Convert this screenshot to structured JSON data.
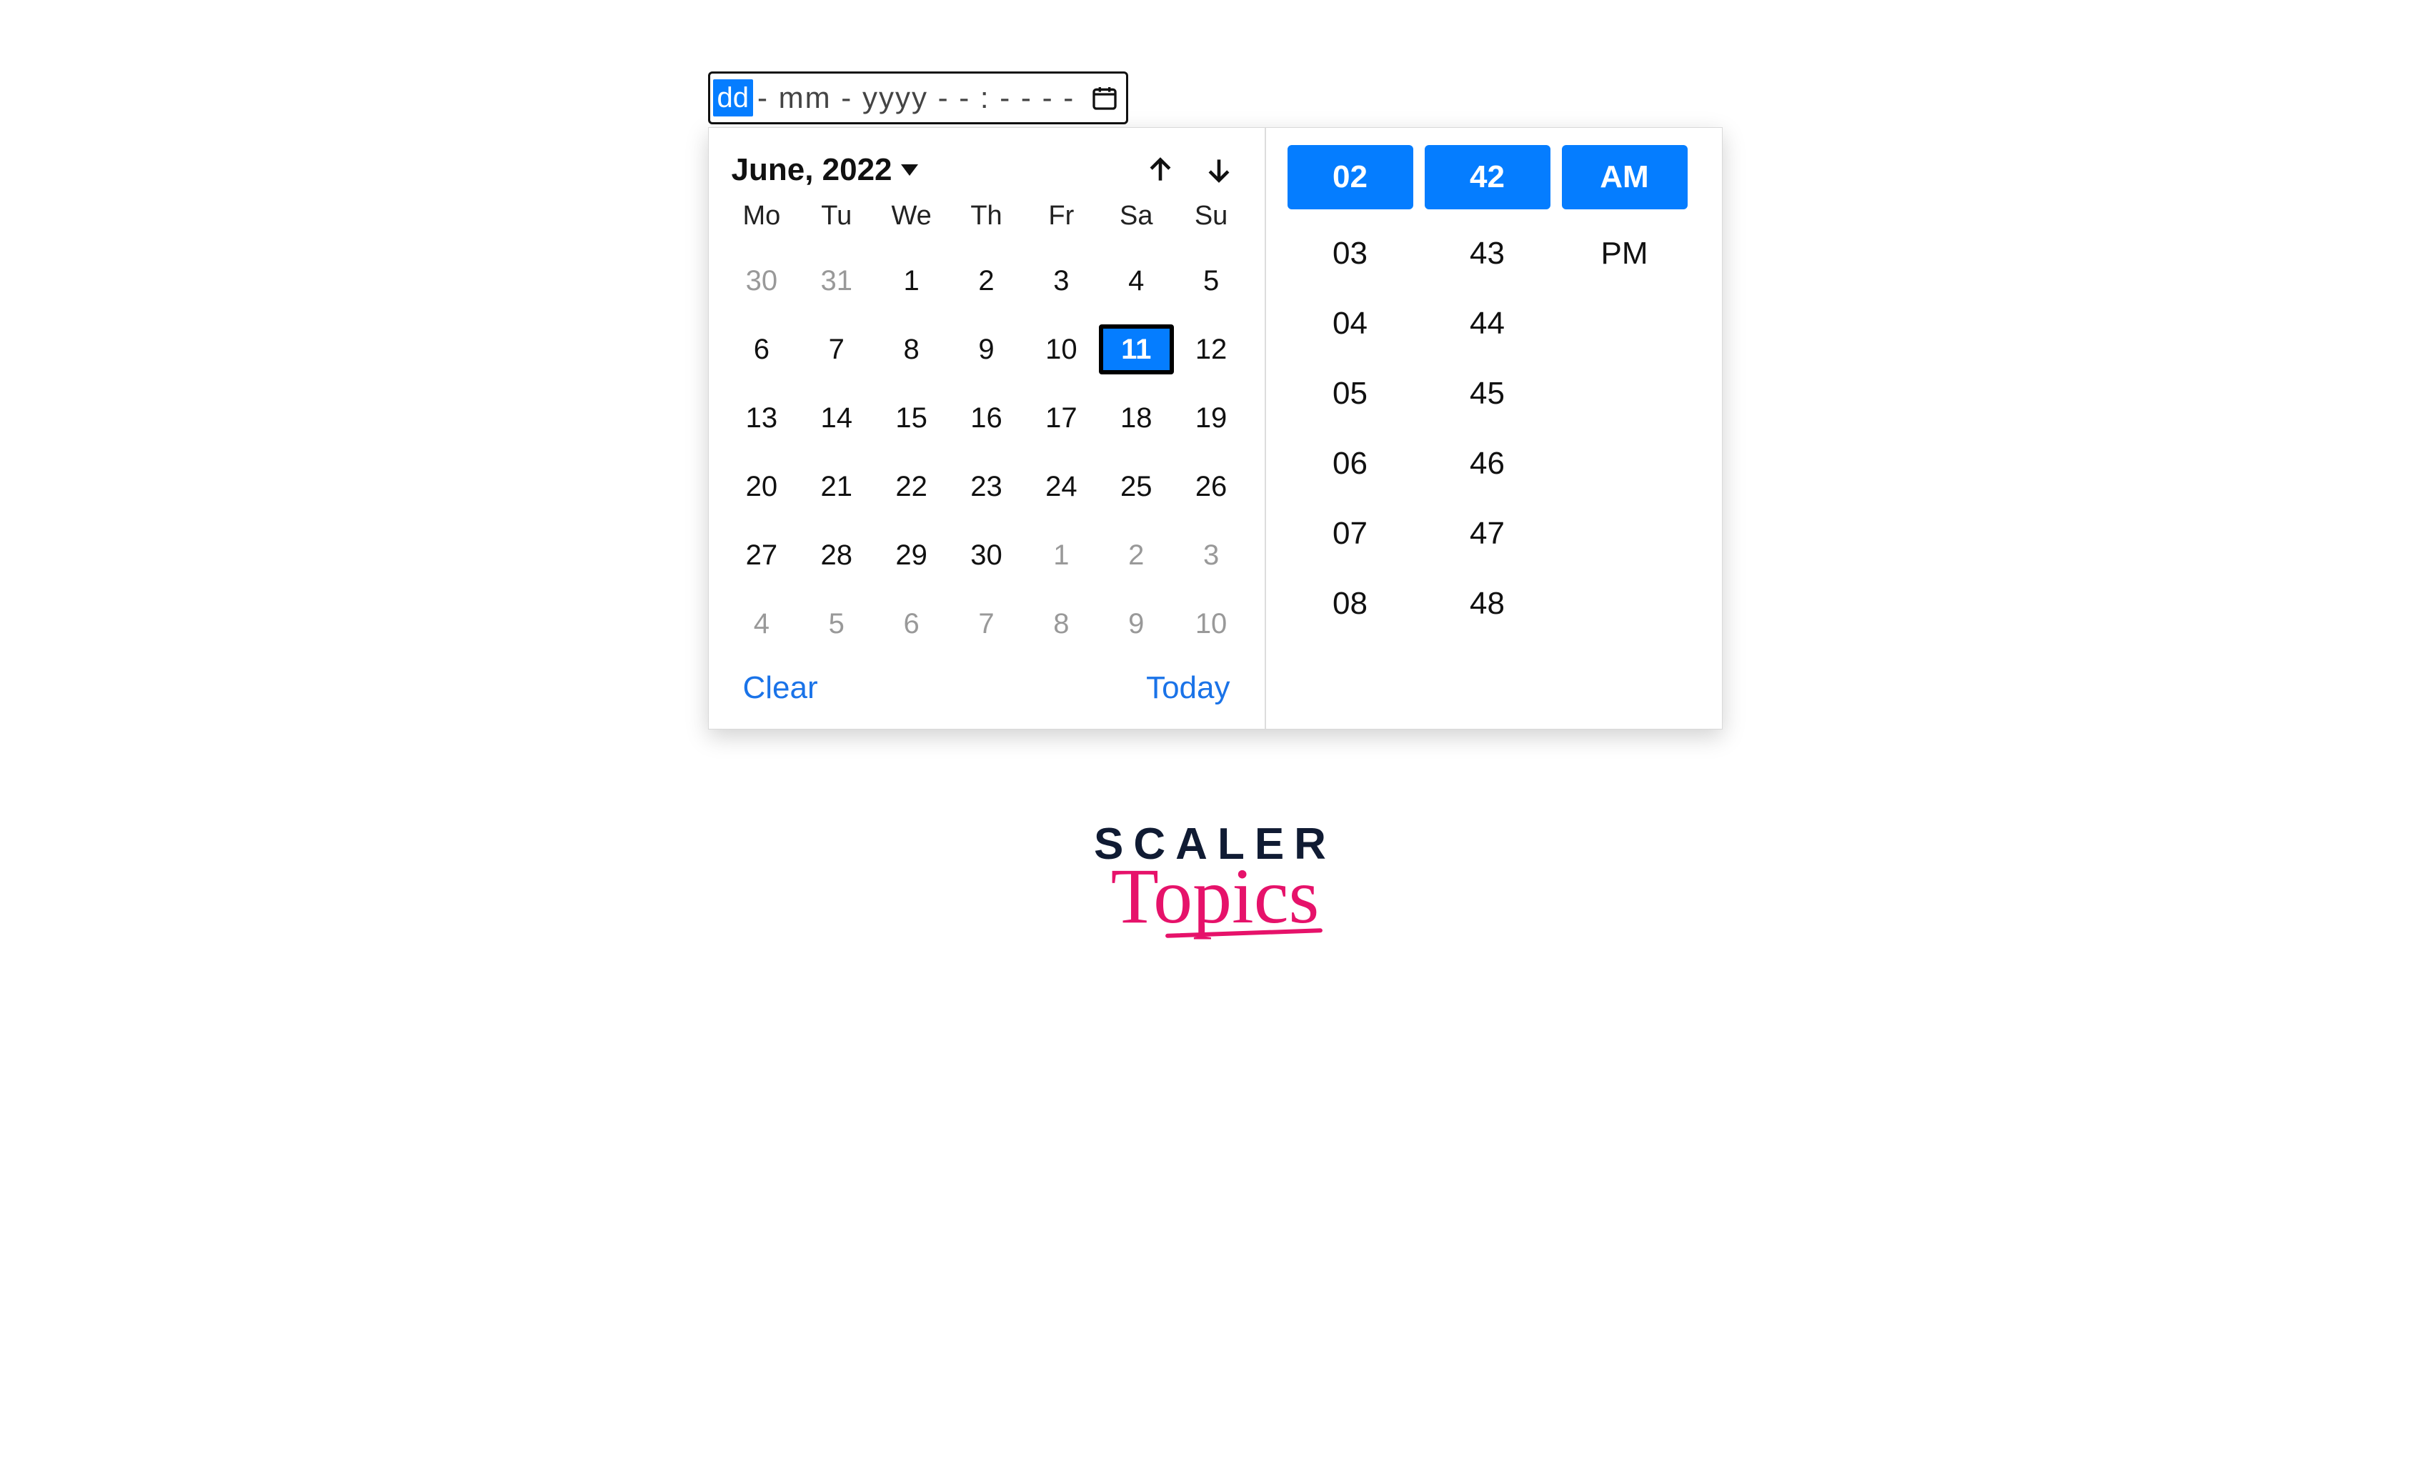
{
  "input": {
    "dd_chip": "dd",
    "rest": "- mm - yyyy   - - : - -    - -"
  },
  "calendar": {
    "month_label": "June, 2022",
    "dow": [
      "Mo",
      "Tu",
      "We",
      "Th",
      "Fr",
      "Sa",
      "Su"
    ],
    "days": [
      {
        "n": "30",
        "other": true
      },
      {
        "n": "31",
        "other": true
      },
      {
        "n": "1"
      },
      {
        "n": "2"
      },
      {
        "n": "3"
      },
      {
        "n": "4"
      },
      {
        "n": "5"
      },
      {
        "n": "6"
      },
      {
        "n": "7"
      },
      {
        "n": "8"
      },
      {
        "n": "9"
      },
      {
        "n": "10"
      },
      {
        "n": "11",
        "selected": true
      },
      {
        "n": "12"
      },
      {
        "n": "13"
      },
      {
        "n": "14"
      },
      {
        "n": "15"
      },
      {
        "n": "16"
      },
      {
        "n": "17"
      },
      {
        "n": "18"
      },
      {
        "n": "19"
      },
      {
        "n": "20"
      },
      {
        "n": "21"
      },
      {
        "n": "22"
      },
      {
        "n": "23"
      },
      {
        "n": "24"
      },
      {
        "n": "25"
      },
      {
        "n": "26"
      },
      {
        "n": "27"
      },
      {
        "n": "28"
      },
      {
        "n": "29"
      },
      {
        "n": "30"
      },
      {
        "n": "1",
        "other": true
      },
      {
        "n": "2",
        "other": true
      },
      {
        "n": "3",
        "other": true
      },
      {
        "n": "4",
        "other": true
      },
      {
        "n": "5",
        "other": true
      },
      {
        "n": "6",
        "other": true
      },
      {
        "n": "7",
        "other": true
      },
      {
        "n": "8",
        "other": true
      },
      {
        "n": "9",
        "other": true
      },
      {
        "n": "10",
        "other": true
      }
    ],
    "clear": "Clear",
    "today": "Today"
  },
  "time": {
    "hour_selected": "02",
    "hour_options": [
      "03",
      "04",
      "05",
      "06",
      "07",
      "08"
    ],
    "minute_selected": "42",
    "minute_options": [
      "43",
      "44",
      "45",
      "46",
      "47",
      "48"
    ],
    "ampm_selected": "AM",
    "ampm_options": [
      "PM"
    ]
  },
  "brand": {
    "top": "SCALER",
    "bottom": "Topics"
  }
}
